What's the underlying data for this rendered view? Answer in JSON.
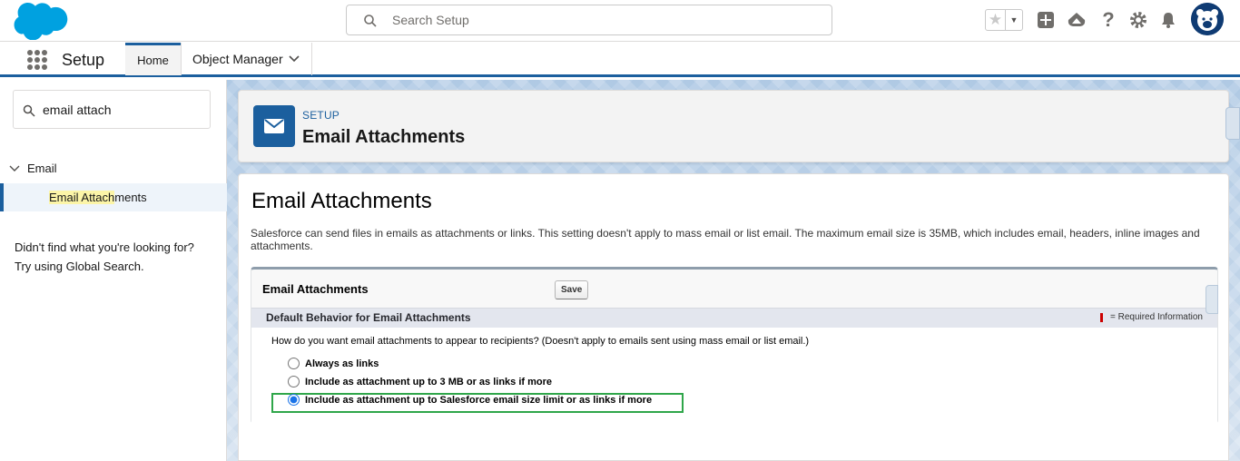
{
  "header": {
    "search_placeholder": "Search Setup"
  },
  "context_bar": {
    "app_name": "Setup",
    "tabs": [
      {
        "label": "Home",
        "active": true
      },
      {
        "label": "Object Manager",
        "active": false
      }
    ]
  },
  "left_panel": {
    "quick_find_value": "email attach",
    "tree_parent": "Email",
    "tree_child_highlight": "Email Attach",
    "tree_child_rest": "ments",
    "not_found_line1": "Didn't find what you're looking for?",
    "not_found_line2": "Try using Global Search."
  },
  "page_header": {
    "eyebrow": "SETUP",
    "title": "Email Attachments"
  },
  "content": {
    "heading": "Email Attachments",
    "description": "Salesforce can send files in emails as attachments or links. This setting doesn't apply to mass email or list email. The maximum email size is 35MB, which includes email, headers, inline images and attachments.",
    "block_title": "Email Attachments",
    "save_label": "Save",
    "section_title": "Default Behavior for Email Attachments",
    "required_info": "= Required Information",
    "question": "How do you want email attachments to appear to recipients? (Doesn't apply to emails sent using mass email or list email.)",
    "options": [
      {
        "label": "Always as links",
        "selected": false
      },
      {
        "label": "Include as attachment up to 3 MB or as links if more",
        "selected": false
      },
      {
        "label": "Include as attachment up to Salesforce email size limit or as links if more",
        "selected": true
      }
    ]
  },
  "colors": {
    "brand_blue": "#1b5f9e",
    "highlight_green": "#2fa64a",
    "required_red": "#cc0000"
  }
}
